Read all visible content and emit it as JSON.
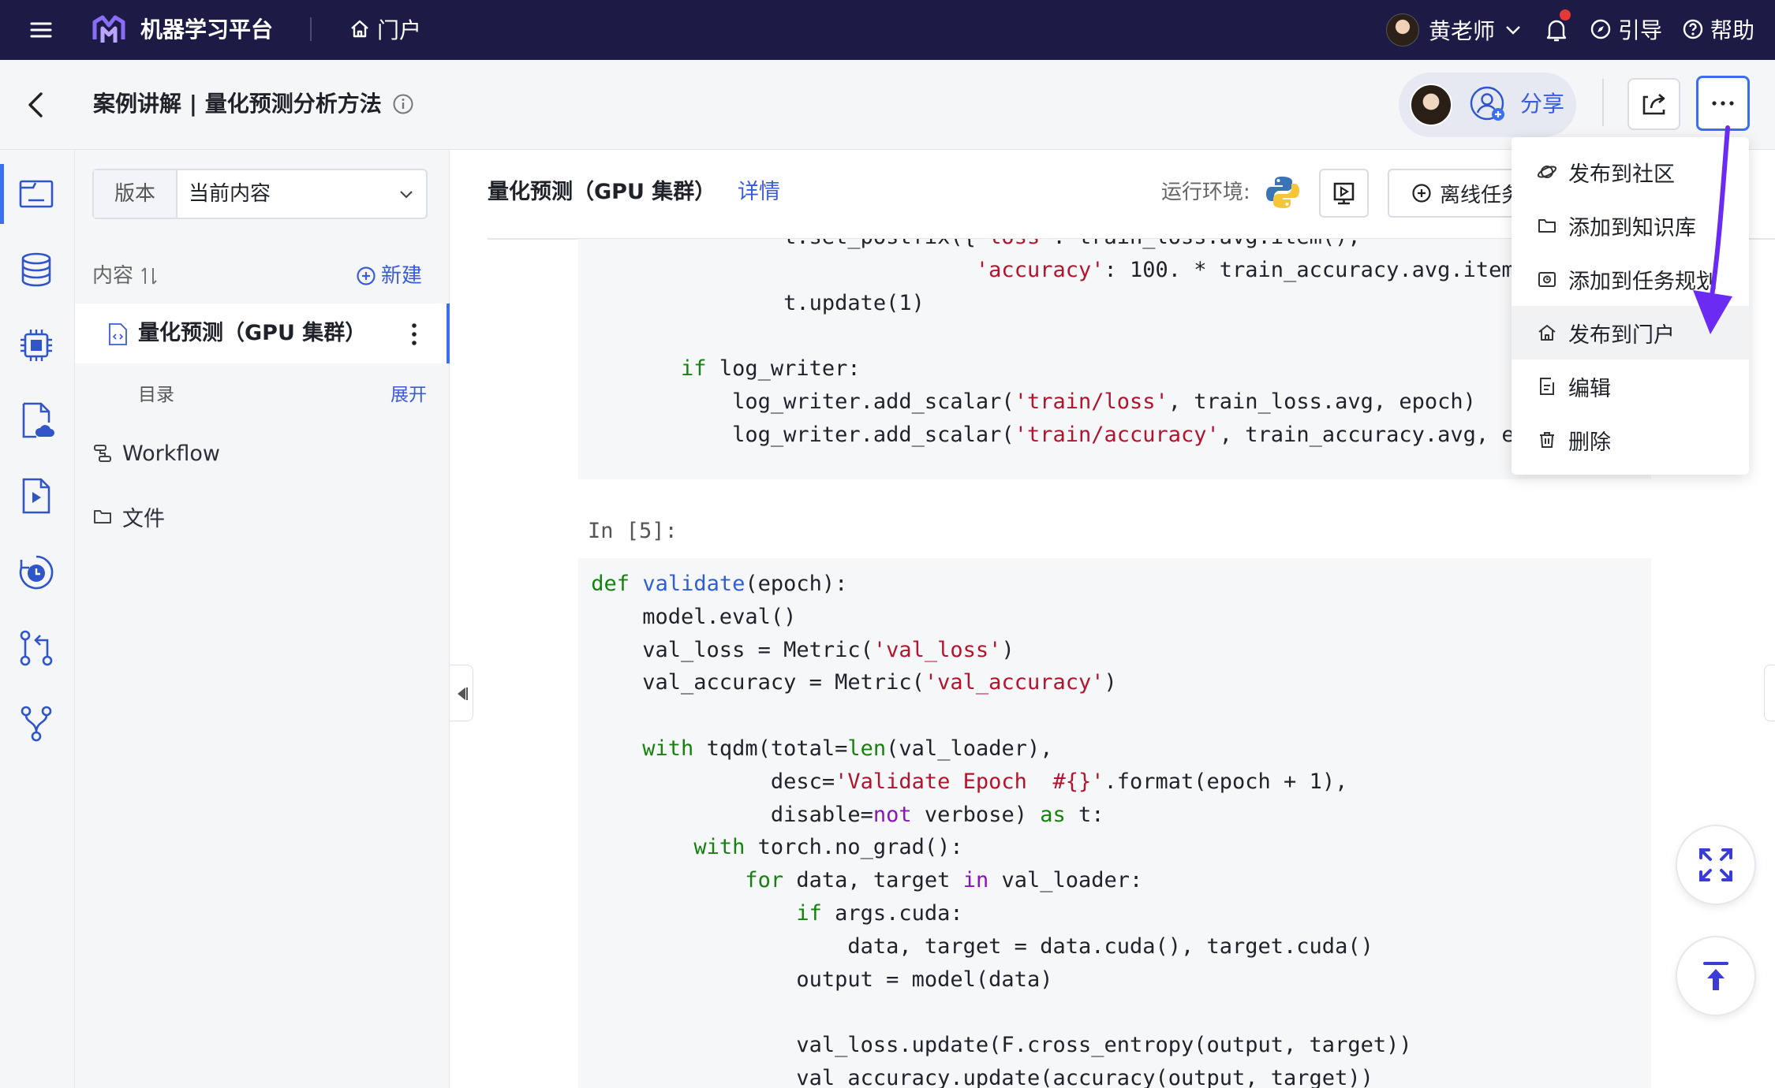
{
  "topbar": {
    "menu_icon": "hamburger-icon",
    "app_name": "机器学习平台",
    "portal_label": "门户",
    "user_name": "黄老师",
    "guide_label": "引导",
    "help_label": "帮助",
    "colors": {
      "bg": "#1c1b46",
      "logo": "#8a6df7",
      "notify_dot": "#e53935"
    }
  },
  "header": {
    "title": "案例讲解 | 量化预测分析方法",
    "share_label": "分享",
    "icons": [
      "back-arrow-icon",
      "info-icon",
      "add-user-icon",
      "export-icon",
      "more-icon"
    ]
  },
  "rail": {
    "icons": [
      "notebook-icon",
      "database-icon",
      "chip-icon",
      "cloud-file-icon",
      "video-file-icon",
      "clock-icon",
      "git-compare-icon",
      "git-branch-icon"
    ]
  },
  "panel": {
    "version_label": "版本",
    "version_value": "当前内容",
    "content_label": "内容",
    "new_label": "新建",
    "file_name": "量化预测（GPU 集群）",
    "toc_label": "目录",
    "expand_label": "展开",
    "nav": [
      {
        "label": "Workflow",
        "icon": "workflow-icon"
      },
      {
        "label": "文件",
        "icon": "folder-icon"
      }
    ]
  },
  "main": {
    "notebook_title": "量化预测（GPU 集群）",
    "details_label": "详情",
    "runtime_label": "运行环境:",
    "runtime_icon": "python-icon",
    "offline_task_label": "离线任务",
    "prompt": "In [5]:"
  },
  "menu": {
    "items": [
      {
        "label": "发布到社区",
        "icon": "planet-icon",
        "highlighted": false
      },
      {
        "label": "添加到知识库",
        "icon": "folder-icon",
        "highlighted": false
      },
      {
        "label": "添加到任务规划",
        "icon": "task-icon",
        "highlighted": false
      },
      {
        "label": "发布到门户",
        "icon": "home-icon",
        "highlighted": true
      },
      {
        "label": "编辑",
        "icon": "edit-icon",
        "highlighted": false
      },
      {
        "label": "删除",
        "icon": "trash-icon",
        "highlighted": false
      }
    ]
  },
  "annotation": {
    "color": "#6b2bf2"
  }
}
